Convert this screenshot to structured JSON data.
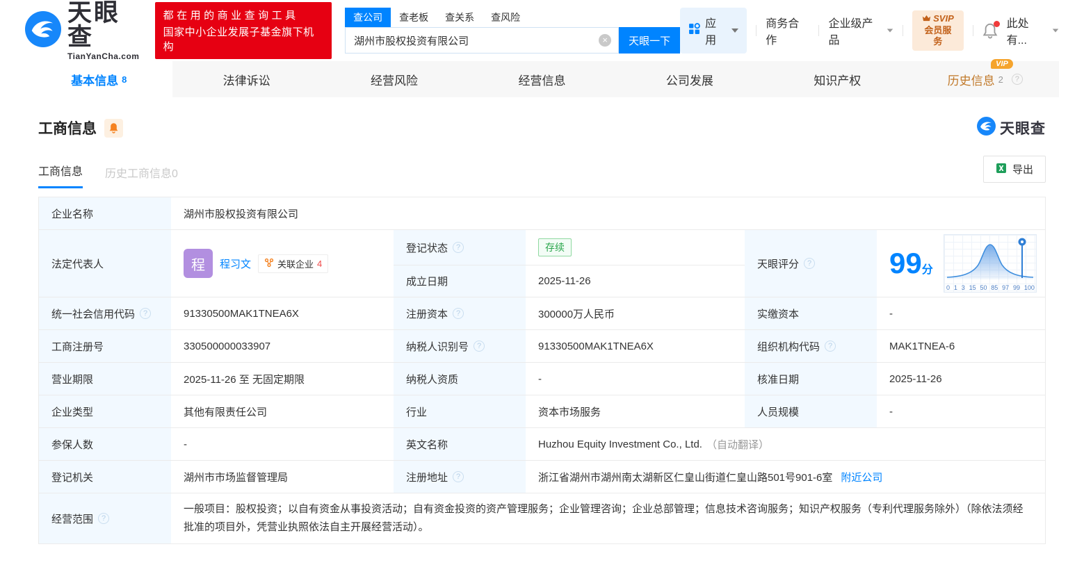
{
  "header": {
    "brand": "天眼查",
    "brand_domain": "TianYanCha.com",
    "banner_line1": "都在用的商业查询工具",
    "banner_line2": "国家中小企业发展子基金旗下机构",
    "search_tabs": [
      "查公司",
      "查老板",
      "查关系",
      "查风险"
    ],
    "search_value": "湖州市股权投资有限公司",
    "search_button": "天眼一下",
    "nav_apps": "应用",
    "nav_cooperation": "商务合作",
    "nav_enterprise": "企业级产品",
    "nav_svip_top": "SVIP",
    "nav_svip_bottom": "会员服务",
    "nav_more": "此处有..."
  },
  "main_tabs": [
    {
      "label": "基本信息",
      "count": "8"
    },
    {
      "label": "法律诉讼"
    },
    {
      "label": "经营风险"
    },
    {
      "label": "经营信息"
    },
    {
      "label": "公司发展"
    },
    {
      "label": "知识产权"
    },
    {
      "label": "历史信息",
      "count": "2",
      "vip": "VIP"
    }
  ],
  "section": {
    "title": "工商信息",
    "watermark": "天眼查",
    "subtab_active": "工商信息",
    "subtab_inactive": "历史工商信息0",
    "export_label": "导出"
  },
  "table": {
    "company_name": {
      "label": "企业名称",
      "value": "湖州市股权投资有限公司"
    },
    "legal_rep": {
      "label": "法定代表人",
      "avatar": "程",
      "name": "程习文",
      "related_label": "关联企业",
      "related_count": "4"
    },
    "reg_status": {
      "label": "登记状态",
      "value": "存续"
    },
    "est_date": {
      "label": "成立日期",
      "value": "2025-11-26"
    },
    "score": {
      "label": "天眼评分",
      "value": "99",
      "unit": "分",
      "axis_ticks": [
        "0",
        "1",
        "3",
        "15",
        "50",
        "85",
        "97",
        "99",
        "100"
      ]
    },
    "credit_code": {
      "label": "统一社会信用代码",
      "value": "91330500MAK1TNEA6X"
    },
    "reg_capital": {
      "label": "注册资本",
      "value": "300000万人民币"
    },
    "paid_capital": {
      "label": "实缴资本",
      "value": "-"
    },
    "reg_number": {
      "label": "工商注册号",
      "value": "330500000033907"
    },
    "taxpayer_id": {
      "label": "纳税人识别号",
      "value": "91330500MAK1TNEA6X"
    },
    "org_code": {
      "label": "组织机构代码",
      "value": "MAK1TNEA-6"
    },
    "business_term": {
      "label": "营业期限",
      "value": "2025-11-26 至 无固定期限"
    },
    "taxpayer_quality": {
      "label": "纳税人资质",
      "value": "-"
    },
    "approval_date": {
      "label": "核准日期",
      "value": "2025-11-26"
    },
    "company_type": {
      "label": "企业类型",
      "value": "其他有限责任公司"
    },
    "industry": {
      "label": "行业",
      "value": "资本市场服务"
    },
    "staff_size": {
      "label": "人员规模",
      "value": "-"
    },
    "insured_count": {
      "label": "参保人数",
      "value": "-"
    },
    "english_name": {
      "label": "英文名称",
      "value": "Huzhou Equity Investment Co., Ltd.",
      "note": "（自动翻译）"
    },
    "reg_authority": {
      "label": "登记机关",
      "value": "湖州市市场监督管理局"
    },
    "reg_address": {
      "label": "注册地址",
      "value": "浙江省湖州市湖州南太湖新区仁皇山街道仁皇山路501号901-6室",
      "link": "附近公司"
    },
    "business_scope": {
      "label": "经营范围",
      "value": "一般项目：股权投资；以自有资金从事投资活动；自有资金投资的资产管理服务；企业管理咨询；企业总部管理；信息技术咨询服务；知识产权服务（专利代理服务除外）（除依法须经批准的项目外，凭营业执照依法自主开展经营活动）。"
    }
  },
  "colors": {
    "accent_blue": "#0084ff",
    "banner_red": "#e60012",
    "status_green": "#2aa64c",
    "vip_orange": "#f5a42d",
    "label_bg": "#f2f9ff"
  }
}
